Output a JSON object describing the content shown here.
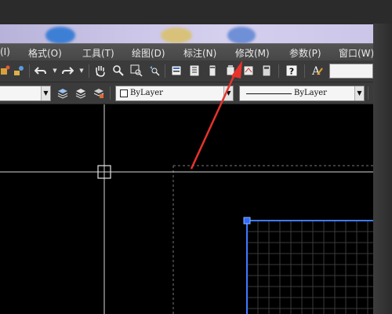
{
  "menubar": {
    "items": [
      {
        "label": "(I)"
      },
      {
        "label": "格式(O)"
      },
      {
        "label": "工具(T)"
      },
      {
        "label": "绘图(D)"
      },
      {
        "label": "标注(N)"
      },
      {
        "label": "修改(M)"
      },
      {
        "label": "参数(P)"
      },
      {
        "label": "窗口(W)"
      }
    ]
  },
  "toolbar": {
    "icons": [
      "paint-icon",
      "undo-icon",
      "redo-icon",
      "pan-hand-icon",
      "zoom-realtime-icon",
      "zoom-window-icon",
      "zoom-previous-icon",
      "properties-icon",
      "design-center-icon",
      "tool-palette-icon",
      "sheet-set-icon",
      "markup-icon",
      "calculator-icon",
      "help-icon",
      "text-style-icon"
    ]
  },
  "properties": {
    "layer_tools": [
      "layer-make-current-icon",
      "layer-previous-icon",
      "layer-state-icon"
    ],
    "color_value": "ByLayer",
    "linetype_value": "ByLayer"
  },
  "colors": {
    "canvas_bg": "#000000",
    "crosshair": "#d9d9d9",
    "selection_blue": "#3d7bff",
    "grid": "#3a3a3a",
    "annotation_arrow": "#e8322c"
  }
}
